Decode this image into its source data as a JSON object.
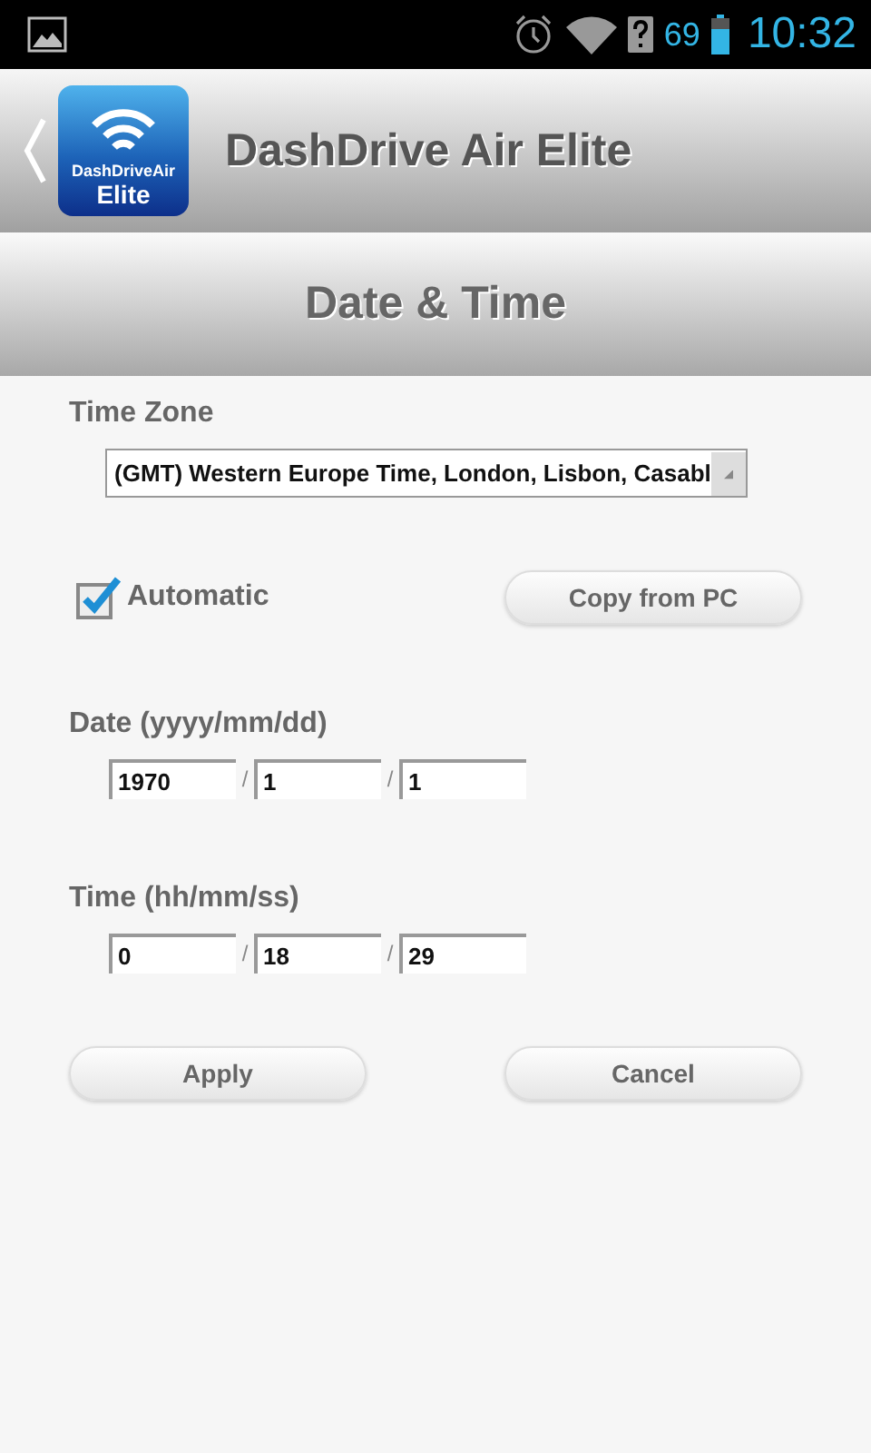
{
  "status_bar": {
    "battery": "69",
    "time": "10:32"
  },
  "app_bar": {
    "logo_lines": [
      "DashDriveAir",
      "Elite"
    ],
    "title": "DashDrive Air Elite"
  },
  "section_title": "Date & Time",
  "time_zone": {
    "label": "Time Zone",
    "value": "(GMT) Western Europe Time, London, Lisbon, Casabl"
  },
  "automatic": {
    "label": "Automatic",
    "checked": true
  },
  "copy_button": "Copy from PC",
  "date": {
    "label": "Date (yyyy/mm/dd)",
    "separator": "/",
    "fields": [
      "1970",
      "1",
      "1"
    ]
  },
  "time": {
    "label": "Time (hh/mm/ss)",
    "separator": "/",
    "fields": [
      "0",
      "18",
      "29"
    ]
  },
  "buttons": [
    "Apply",
    "Cancel"
  ]
}
